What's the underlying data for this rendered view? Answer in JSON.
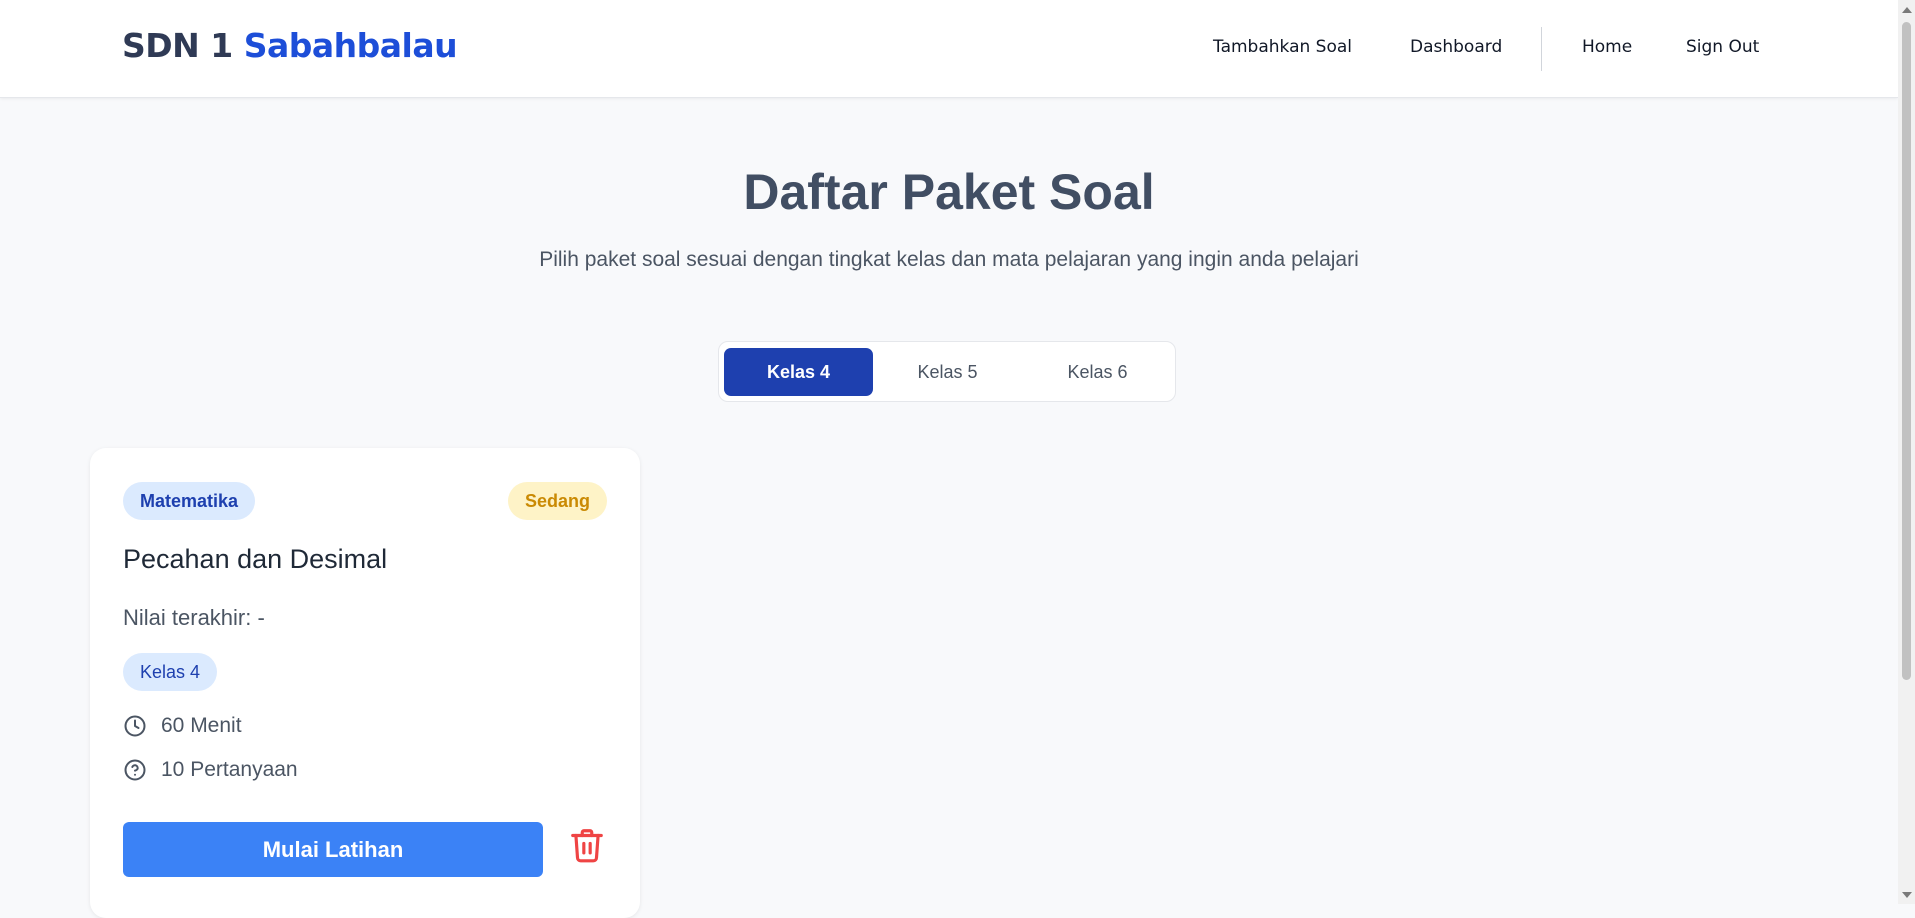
{
  "brand": {
    "part1": "SDN 1",
    "part2": "Sabahbalau"
  },
  "nav": {
    "items": [
      {
        "label": "Tambahkan Soal"
      },
      {
        "label": "Dashboard"
      },
      {
        "label": "Home"
      },
      {
        "label": "Sign Out"
      }
    ]
  },
  "header": {
    "title": "Daftar Paket Soal",
    "subtitle": "Pilih paket soal sesuai dengan tingkat kelas dan mata pelajaran yang ingin anda pelajari"
  },
  "tabs": [
    {
      "label": "Kelas 4",
      "active": true
    },
    {
      "label": "Kelas 5",
      "active": false
    },
    {
      "label": "Kelas 6",
      "active": false
    }
  ],
  "cards": [
    {
      "subject": "Matematika",
      "difficulty": "Sedang",
      "title": "Pecahan dan Desimal",
      "last_score": "Nilai terakhir: -",
      "class_label": "Kelas 4",
      "duration": "60 Menit",
      "questions": "10 Pertanyaan",
      "start_label": "Mulai Latihan"
    }
  ],
  "colors": {
    "brand_accent": "#1d4ed8",
    "active_tab": "#1e40af",
    "primary_button": "#3b82f6",
    "difficulty_bg": "#fef3c7",
    "difficulty_text": "#ca8a04",
    "delete_icon": "#ef4444"
  },
  "icons": [
    "clock-icon",
    "question-circle-icon",
    "trash-icon"
  ]
}
